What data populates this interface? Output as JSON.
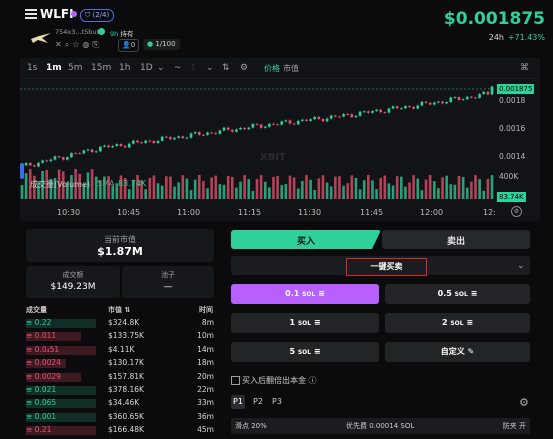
{
  "header": {
    "token_name": "WLFI",
    "holders_badge": "(2/4)",
    "address": "754x3...t5but",
    "age": "9h",
    "hold_label": "持有",
    "badge_zero": "0",
    "badge_ratio": "1/100",
    "price": "$0.001875",
    "change_period": "24h",
    "change_value": "+71.43%"
  },
  "toolbar": {
    "intervals": [
      "1s",
      "1m",
      "5m",
      "15m",
      "1h",
      "1D"
    ],
    "active_interval": "1m",
    "price_label": "价格",
    "mcap_label": "市值"
  },
  "chart": {
    "volume_label": "成交量(Volume)",
    "sma_label": "SMA",
    "sma_value": "83.74K",
    "volume_tag": "83.74K",
    "price_tag": "0.001875",
    "watermark": "XBIT",
    "y_ticks": [
      "0.0018",
      "0.0016",
      "0.0014",
      "400K"
    ],
    "x_ticks": [
      "10:30",
      "10:45",
      "11:00",
      "11:15",
      "11:30",
      "11:45",
      "12:00",
      "12:"
    ]
  },
  "chart_data": {
    "type": "candlestick",
    "x": [
      "10:30",
      "10:45",
      "11:00",
      "11:15",
      "11:30",
      "11:45",
      "12:00"
    ],
    "price": [
      0.00136,
      0.00148,
      0.00155,
      0.00162,
      0.00168,
      0.00175,
      0.00183
    ],
    "last_price": 0.001875,
    "y_ticks": [
      0.0014,
      0.0016,
      0.0018
    ],
    "volume_sma": "83.74K"
  },
  "left": {
    "mcap_label": "当前市值",
    "mcap_value": "$1.87M",
    "volume_label": "成交额",
    "volume_value": "$149.23M",
    "pool_label": "池子",
    "pool_value": "—",
    "col_volume": "成交量",
    "col_mcap": "市值",
    "col_time": "时间",
    "trades": [
      {
        "amount": "0.22",
        "mcap": "$324.8K",
        "time": "8m",
        "side": "buy"
      },
      {
        "amount": "0.011",
        "mcap": "$133.75K",
        "time": "10m",
        "side": "sell"
      },
      {
        "amount": "0.0₄51",
        "mcap": "$4.11K",
        "time": "14m",
        "side": "sell"
      },
      {
        "amount": "0.0024",
        "mcap": "$130.17K",
        "time": "18m",
        "side": "sell"
      },
      {
        "amount": "0.0029",
        "mcap": "$157.81K",
        "time": "20m",
        "side": "sell"
      },
      {
        "amount": "0.021",
        "mcap": "$378.16K",
        "time": "22m",
        "side": "buy"
      },
      {
        "amount": "0.065",
        "mcap": "$34.46K",
        "time": "33m",
        "side": "buy"
      },
      {
        "amount": "0.001",
        "mcap": "$360.65K",
        "time": "36m",
        "side": "buy"
      },
      {
        "amount": "0.21",
        "mcap": "$166.48K",
        "time": "45m",
        "side": "sell"
      }
    ]
  },
  "right": {
    "buy_tab": "买入",
    "sell_tab": "卖出",
    "mode": "一键买卖",
    "amounts": [
      {
        "value": "0.1",
        "unit": "SOL",
        "selected": true
      },
      {
        "value": "0.5",
        "unit": "SOL",
        "selected": false
      },
      {
        "value": "1",
        "unit": "SOL",
        "selected": false
      },
      {
        "value": "2",
        "unit": "SOL",
        "selected": false
      },
      {
        "value": "5",
        "unit": "SOL",
        "selected": false
      }
    ],
    "custom": "自定义",
    "auto_sell_label": "买入后翻倍出本金",
    "presets": [
      "P1",
      "P2",
      "P3"
    ],
    "slippage": "滑点 20%",
    "priority_fee": "优先费 0.00014 SOL",
    "mev": "防夹 开"
  },
  "colors": {
    "buy": "#2fd19b",
    "sell": "#f0506e",
    "accent": "#b760ff",
    "highlight": "#e02424"
  }
}
